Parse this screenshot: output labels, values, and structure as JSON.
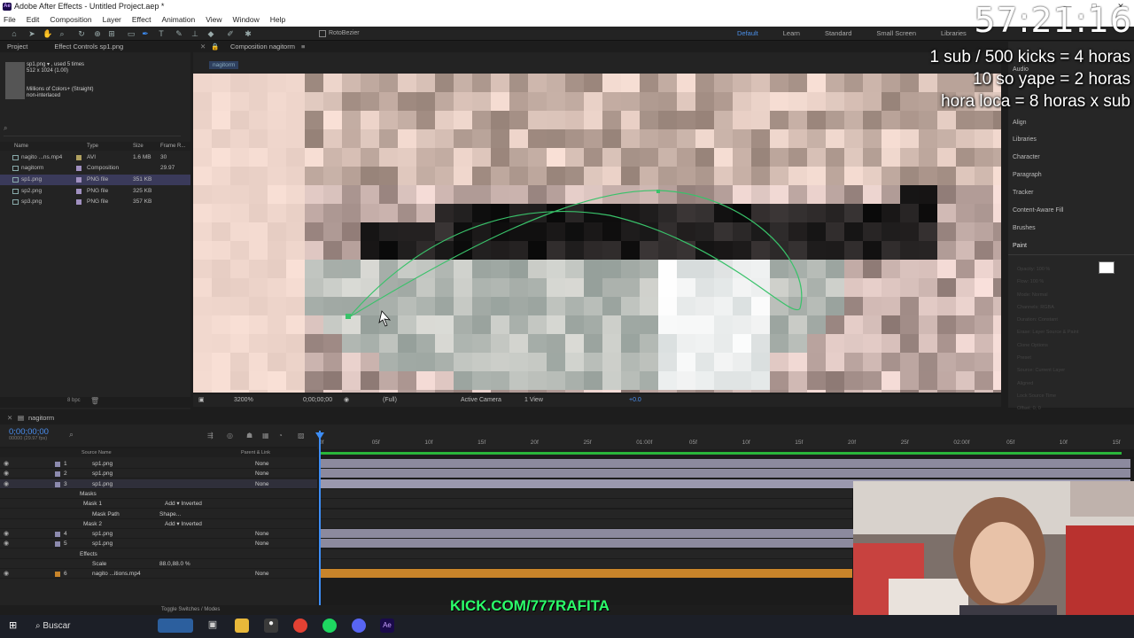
{
  "window": {
    "title": "Adobe After Effects - Untitled Project.aep *",
    "controls": [
      "—",
      "□",
      "✕"
    ]
  },
  "menu": [
    "File",
    "Edit",
    "Composition",
    "Layer",
    "Effect",
    "Animation",
    "View",
    "Window",
    "Help"
  ],
  "toolbar": {
    "roto_label": "RotoBezier"
  },
  "workspaces": [
    "Default",
    "Learn",
    "Standard",
    "Small Screen",
    "Libraries"
  ],
  "stream": {
    "timer": "57:21:16",
    "overlay_lines": [
      "1 sub / 500 kicks = 4 horas",
      "10 so yape = 2 horas",
      "hora loca = 8 horas x sub"
    ],
    "kick": "KICK.COM/777RAFITA"
  },
  "project": {
    "tab": "Project",
    "tab2": "Effect Controls  sp1.png",
    "selected_name": "sp1.png ▾ , used 5 times",
    "selected_dims": "512 x 1024 (1.00)",
    "selected_color": "Millions of Colors+ (Straight)",
    "selected_interlace": "non-interlaced",
    "columns": [
      "Name",
      "Type",
      "Size",
      "Frame R..."
    ],
    "items": [
      {
        "name": "nagito ...ns.mp4",
        "type": "AVI",
        "size": "1.6 MB",
        "fr": "30",
        "label": "#b0a060"
      },
      {
        "name": "nagitorm",
        "type": "Composition",
        "size": "",
        "fr": "29.97",
        "label": "#a090c0"
      },
      {
        "name": "sp1.png",
        "type": "PNG file",
        "size": "351 KB",
        "fr": "",
        "label": "#a090c0"
      },
      {
        "name": "sp2.png",
        "type": "PNG file",
        "size": "325 KB",
        "fr": "",
        "label": "#a090c0"
      },
      {
        "name": "sp3.png",
        "type": "PNG file",
        "size": "357 KB",
        "fr": "",
        "label": "#a090c0"
      }
    ],
    "bpc": "8 bpc"
  },
  "composition": {
    "tab": "Composition  nagitorm",
    "subtab": "nagitorm",
    "zoom": "3200%",
    "time": "0;00;00;00",
    "resolution": "(Full)",
    "camera": "Active Camera",
    "views": "1 View",
    "exposure": "+0.0"
  },
  "right_panels": [
    "Audio",
    "Align",
    "Libraries",
    "Character",
    "Paragraph",
    "Tracker",
    "Content-Aware Fill",
    "Brushes",
    "Paint"
  ],
  "paint_fields": [
    "Opacity: 100 %",
    "Flow: 100 %",
    "Mode: Normal",
    "Channels: RGBA",
    "Duration: Constant",
    "Erase: Layer Source & Paint",
    "Clone Options",
    "Preset",
    "Source: Current Layer",
    "Aligned",
    "Lock Source Time",
    "Offset: 0, 0"
  ],
  "timeline": {
    "tab": "nagitorm",
    "timecode": "0;00;00;00",
    "timecode_sub": "00000 (29.97 fps)",
    "columns": [
      "Source Name",
      "Parent & Link"
    ],
    "ruler_ticks": [
      "0f",
      "05f",
      "10f",
      "15f",
      "20f",
      "25f",
      "01:00f",
      "05f",
      "10f",
      "15f",
      "20f",
      "25f",
      "02:00f",
      "05f",
      "10f",
      "15f"
    ],
    "layers": [
      {
        "num": "1",
        "name": "sp1.png",
        "parent": "None",
        "kind": "layer"
      },
      {
        "num": "2",
        "name": "sp1.png",
        "parent": "None",
        "kind": "layer"
      },
      {
        "num": "3",
        "name": "sp1.png",
        "parent": "None",
        "kind": "layer-selected"
      },
      {
        "num": "",
        "name": "Masks",
        "parent": "",
        "kind": "group"
      },
      {
        "num": "",
        "name": "Mask 1",
        "parent": "Add   ▾     Inverted",
        "kind": "mask"
      },
      {
        "num": "",
        "name": "Mask Path",
        "parent": "Shape...",
        "kind": "prop"
      },
      {
        "num": "",
        "name": "Mask 2",
        "parent": "Add   ▾     Inverted",
        "kind": "mask"
      },
      {
        "num": "4",
        "name": "sp1.png",
        "parent": "None",
        "kind": "layer"
      },
      {
        "num": "5",
        "name": "sp1.png",
        "parent": "None",
        "kind": "layer"
      },
      {
        "num": "",
        "name": "Effects",
        "parent": "",
        "kind": "group"
      },
      {
        "num": "",
        "name": "Scale",
        "parent": "88.0,88.0 %",
        "kind": "prop"
      },
      {
        "num": "6",
        "name": "nagito ...itions.mp4",
        "parent": "None",
        "kind": "video"
      }
    ],
    "footer": "Toggle Switches / Modes"
  },
  "taskbar": {
    "search": "Buscar"
  },
  "colors": {
    "accent": "#3d8df5",
    "workarea": "#29b53a",
    "kick": "#2bff6a",
    "layer_bar": "#8c8a9e",
    "video_bar": "#c8842a"
  }
}
